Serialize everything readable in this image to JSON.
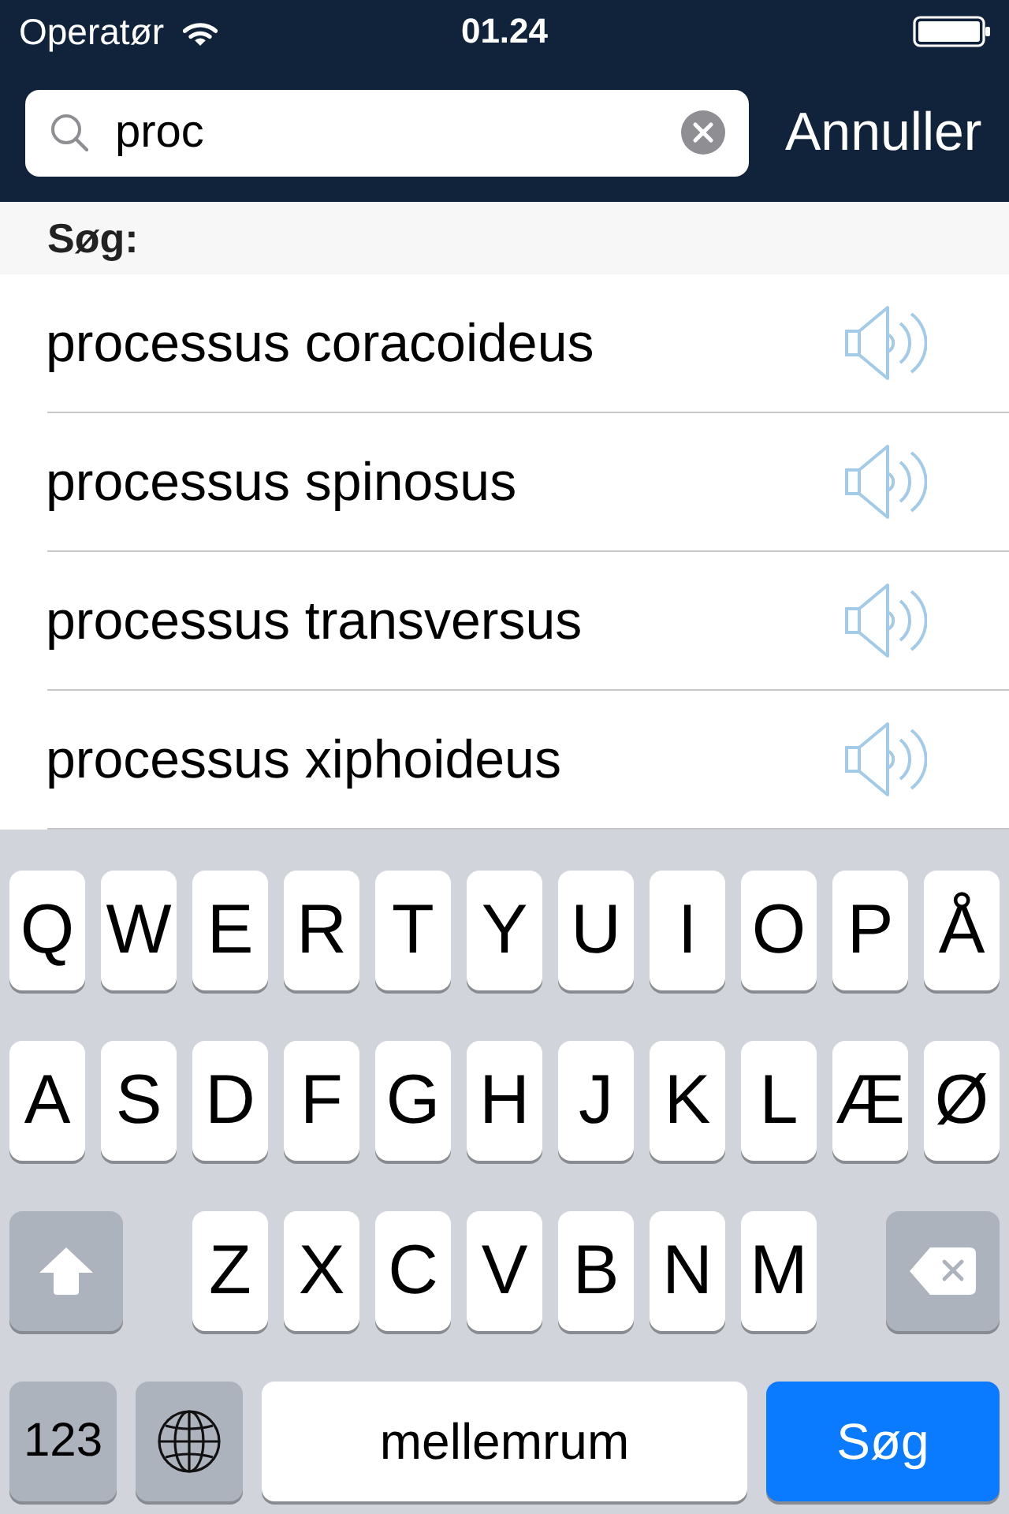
{
  "status_bar": {
    "carrier": "Operatør",
    "time": "01.24"
  },
  "search_bar": {
    "value": "proc",
    "cancel_button": "Annuller"
  },
  "section_header": "Søg:",
  "results": [
    {
      "term": "processus coracoideus"
    },
    {
      "term": "processus spinosus"
    },
    {
      "term": "processus transversus"
    },
    {
      "term": "processus xiphoideus"
    }
  ],
  "keyboard": {
    "rows": [
      {
        "keys": [
          {
            "kind": "letter",
            "label": "Q"
          },
          {
            "kind": "letter",
            "label": "W"
          },
          {
            "kind": "letter",
            "label": "E"
          },
          {
            "kind": "letter",
            "label": "R"
          },
          {
            "kind": "letter",
            "label": "T"
          },
          {
            "kind": "letter",
            "label": "Y"
          },
          {
            "kind": "letter",
            "label": "U"
          },
          {
            "kind": "letter",
            "label": "I"
          },
          {
            "kind": "letter",
            "label": "O"
          },
          {
            "kind": "letter",
            "label": "P"
          },
          {
            "kind": "letter",
            "label": "Å"
          }
        ]
      },
      {
        "keys": [
          {
            "kind": "letter",
            "label": "A"
          },
          {
            "kind": "letter",
            "label": "S"
          },
          {
            "kind": "letter",
            "label": "D"
          },
          {
            "kind": "letter",
            "label": "F"
          },
          {
            "kind": "letter",
            "label": "G"
          },
          {
            "kind": "letter",
            "label": "H"
          },
          {
            "kind": "letter",
            "label": "J"
          },
          {
            "kind": "letter",
            "label": "K"
          },
          {
            "kind": "letter",
            "label": "L"
          },
          {
            "kind": "letter",
            "label": "Æ"
          },
          {
            "kind": "letter",
            "label": "Ø"
          }
        ]
      },
      {
        "keys": [
          {
            "kind": "shift"
          },
          {
            "kind": "letter",
            "label": "Z"
          },
          {
            "kind": "letter",
            "label": "X"
          },
          {
            "kind": "letter",
            "label": "C"
          },
          {
            "kind": "letter",
            "label": "V"
          },
          {
            "kind": "letter",
            "label": "B"
          },
          {
            "kind": "letter",
            "label": "N"
          },
          {
            "kind": "letter",
            "label": "M"
          },
          {
            "kind": "delete"
          }
        ]
      },
      {
        "keys": [
          {
            "kind": "numbers",
            "label": "123"
          },
          {
            "kind": "globe"
          },
          {
            "kind": "space",
            "label": "mellemrum"
          },
          {
            "kind": "action",
            "label": "Søg"
          }
        ]
      }
    ]
  }
}
